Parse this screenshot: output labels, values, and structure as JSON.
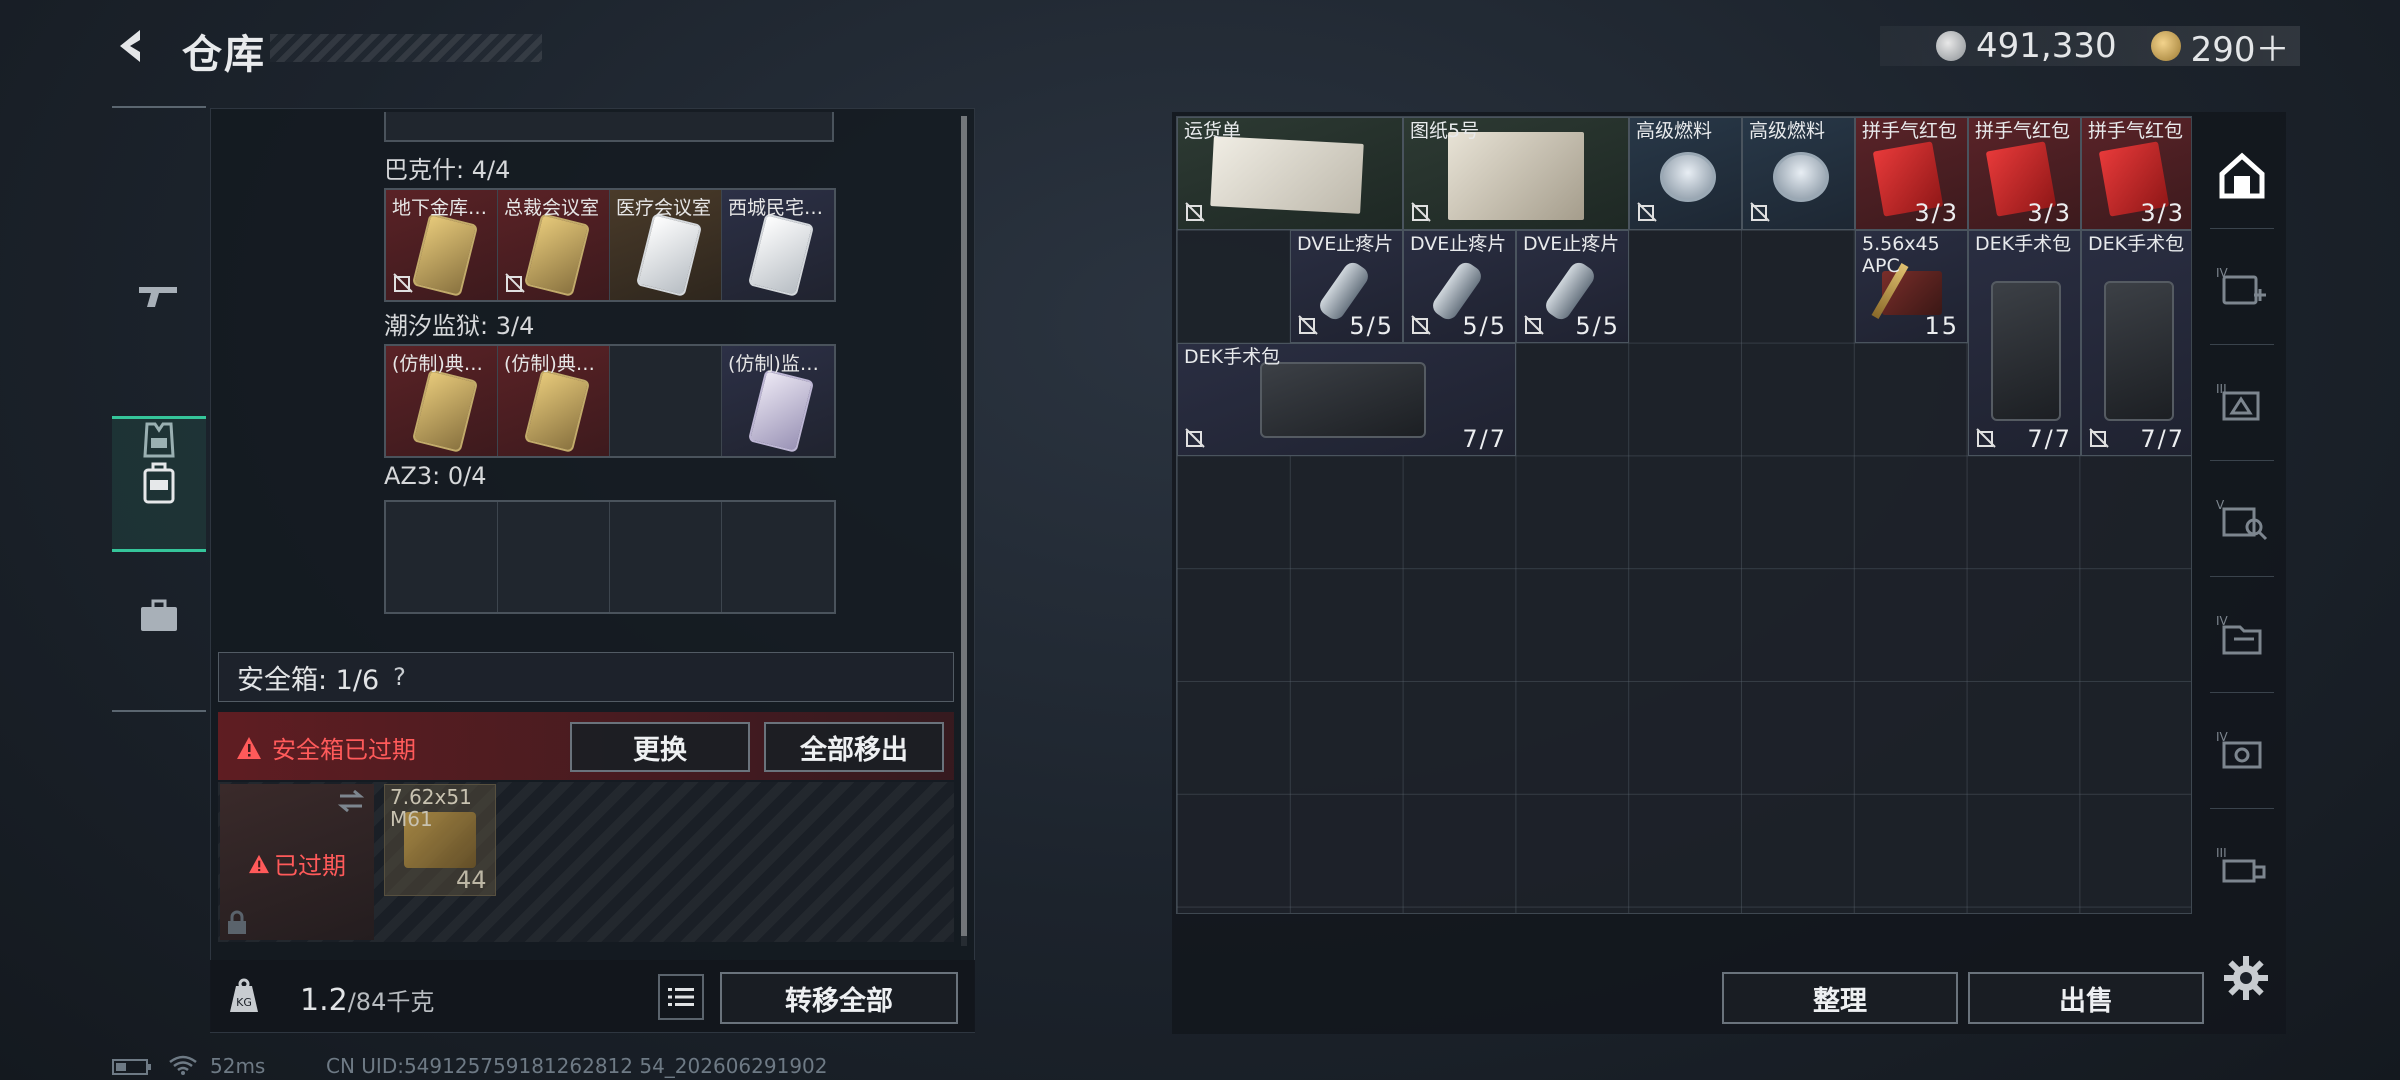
{
  "header": {
    "title": "仓库",
    "currency_silver": "491,330",
    "currency_gold": "290＋"
  },
  "left": {
    "top_label": "巴克什: 4/4",
    "bakeshi_slots": [
      {
        "label": "地下金库…",
        "style": "red",
        "card": "gold"
      },
      {
        "label": "总裁会议室",
        "style": "red",
        "card": "gold"
      },
      {
        "label": "医疗会议室",
        "style": "brown",
        "card": "white"
      },
      {
        "label": "西城民宅…",
        "style": "navy",
        "card": "white"
      }
    ],
    "chaoxi_label": "潮汐监狱: 3/4",
    "chaoxi_slots": [
      {
        "label": "(仿制)典…",
        "style": "red",
        "card": "gold"
      },
      {
        "label": "(仿制)典…",
        "style": "red",
        "card": "gold"
      },
      {
        "label": "",
        "style": "empty",
        "card": ""
      },
      {
        "label": "(仿制)监…",
        "style": "navy",
        "card": "purple"
      }
    ],
    "az3_label": "AZ3: 0/4",
    "safe_label": "安全箱: 1/6",
    "safe_help": "?",
    "safe_expired_warning": "安全箱已过期",
    "replace_button": "更换",
    "move_all_button": "全部移出",
    "expired_badge": "已过期",
    "ammo_label": "7.62x51 M61",
    "ammo_count": "44",
    "weight_current": "1.2",
    "weight_max": "/84千克",
    "transfer_all_button": "转移全部"
  },
  "status": {
    "ping": "52ms",
    "uid": "CN UID:549125759181262812 54_202606291902"
  },
  "stash": {
    "items": {
      "waybill": {
        "label": "运货单"
      },
      "blueprint": {
        "label": "图纸5号"
      },
      "fuel1": {
        "label": "高级燃料"
      },
      "fuel2": {
        "label": "高级燃料"
      },
      "hongbao1": {
        "label": "拼手气红包",
        "count": "3/3"
      },
      "hongbao2": {
        "label": "拼手气红包",
        "count": "3/3"
      },
      "hongbao3": {
        "label": "拼手气红包",
        "count": "3/3"
      },
      "dve1": {
        "label": "DVE止疼片",
        "count": "5/5"
      },
      "dve2": {
        "label": "DVE止疼片",
        "count": "5/5"
      },
      "dve3": {
        "label": "DVE止疼片",
        "count": "5/5"
      },
      "ammo556": {
        "label": "5.56x45 APC",
        "count": "15"
      },
      "dek_v1": {
        "label": "DEK手术包",
        "count": "7/7"
      },
      "dek_v2": {
        "label": "DEK手术包",
        "count": "7/7"
      },
      "dek_h": {
        "label": "DEK手术包",
        "count": "7/7"
      }
    },
    "sort_button": "整理",
    "sell_button": "出售"
  },
  "right_tabs": [
    "home-icon",
    "tier-iv-medical-icon",
    "tier-iii-electronics-icon",
    "tier-v-tools-icon",
    "tier-iv-documents-icon",
    "tier-iv-equipment-icon",
    "tier-iii-materials-icon"
  ],
  "colors": {
    "accent": "#35c59a",
    "warning": "#ff5a5a"
  }
}
